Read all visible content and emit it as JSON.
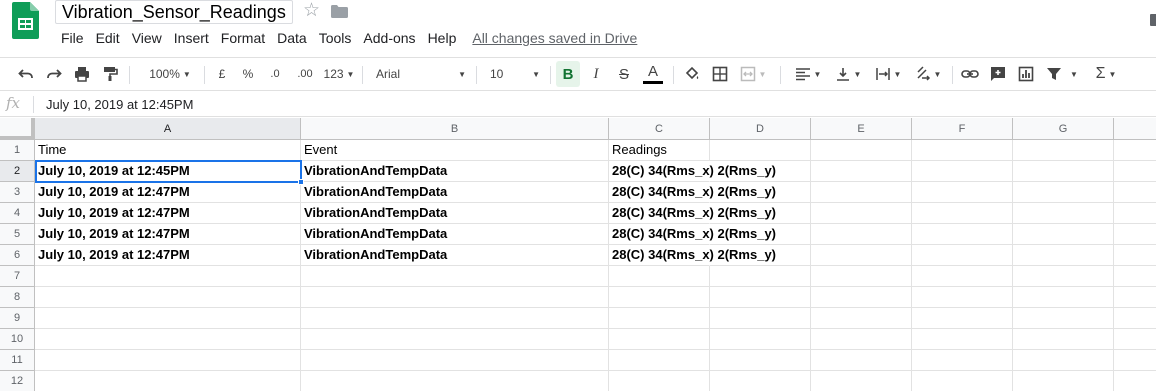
{
  "app": {
    "doc_title": "Vibration_Sensor_Readings",
    "save_status": "All changes saved in Drive",
    "menu": [
      "File",
      "Edit",
      "View",
      "Insert",
      "Format",
      "Data",
      "Tools",
      "Add-ons",
      "Help"
    ]
  },
  "toolbar": {
    "zoom": "100%",
    "currency": "£",
    "percent": "%",
    "decrease_decimals": ".0",
    "increase_decimals": ".00",
    "more_formats": "123",
    "font_name": "Arial",
    "font_size": "10",
    "text_color": "#000000",
    "active_color": "#e6f4ea",
    "icons": [
      "undo-icon",
      "redo-icon",
      "print-icon",
      "paint-format-icon",
      "bold-icon",
      "italic-icon",
      "strikethrough-icon",
      "text-color-icon",
      "fill-color-icon",
      "borders-icon",
      "merge-cells-icon",
      "horizontal-align-icon",
      "vertical-align-icon",
      "text-wrap-icon",
      "text-rotation-icon",
      "link-icon",
      "comment-icon",
      "chart-icon",
      "filter-icon",
      "functions-icon"
    ]
  },
  "formula_bar": {
    "fx_label": "fx",
    "content": "July 10, 2019 at 12:45PM"
  },
  "grid": {
    "columns": [
      "A",
      "B",
      "C",
      "D",
      "E",
      "F",
      "G"
    ],
    "row_numbers": [
      "1",
      "2",
      "3",
      "4",
      "5",
      "6",
      "7",
      "8",
      "9",
      "10",
      "11",
      "12"
    ],
    "header_row": [
      "Time",
      "Event",
      "Readings"
    ],
    "rows": [
      [
        "July 10, 2019 at 12:45PM",
        "VibrationAndTempData",
        "28(C) 34(Rms_x) 2(Rms_y)"
      ],
      [
        "July 10, 2019 at 12:47PM",
        "VibrationAndTempData",
        "28(C) 34(Rms_x) 2(Rms_y)"
      ],
      [
        "July 10, 2019 at 12:47PM",
        "VibrationAndTempData",
        "28(C) 34(Rms_x) 2(Rms_y)"
      ],
      [
        "July 10, 2019 at 12:47PM",
        "VibrationAndTempData",
        "28(C) 34(Rms_x) 2(Rms_y)"
      ],
      [
        "July 10, 2019 at 12:47PM",
        "VibrationAndTempData",
        "28(C) 34(Rms_x) 2(Rms_y)"
      ]
    ],
    "selected_cell": "A2",
    "selection_color": "#1a73e8"
  },
  "colors": {
    "sheets_green": "#0f9d58",
    "header_bg": "#f8f9fa",
    "gridline": "#e2e2e2"
  }
}
